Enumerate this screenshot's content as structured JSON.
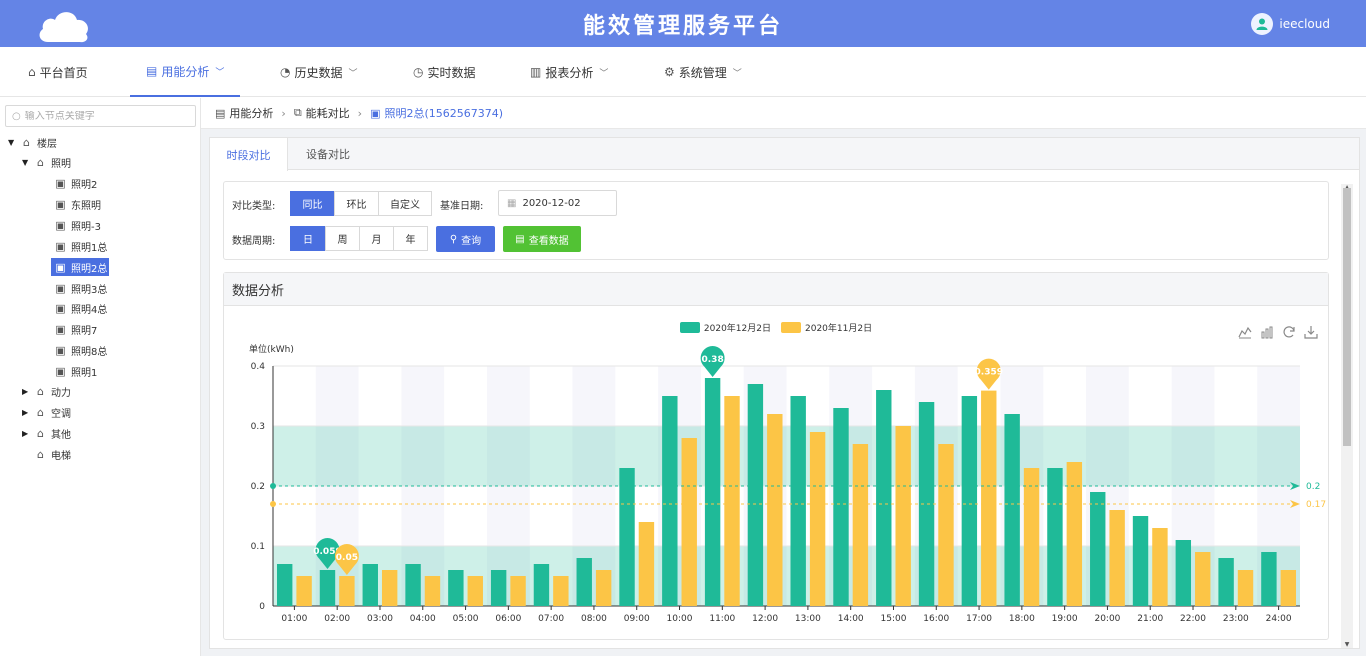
{
  "header": {
    "title": "能效管理服务平台",
    "username": "ieecloud",
    "logo_icon": "cloud-icon",
    "avatar_icon": "user-icon"
  },
  "nav": {
    "items": [
      {
        "label": "平台首页",
        "icon": "home-icon"
      },
      {
        "label": "用能分析",
        "icon": "document-icon",
        "dropdown": true,
        "active": true
      },
      {
        "label": "历史数据",
        "icon": "gauge-icon",
        "dropdown": true
      },
      {
        "label": "实时数据",
        "icon": "clock-icon"
      },
      {
        "label": "报表分析",
        "icon": "bar-chart-icon",
        "dropdown": true
      },
      {
        "label": "系统管理",
        "icon": "gear-icon",
        "dropdown": true
      }
    ]
  },
  "tree": {
    "search_placeholder": "输入节点关键字",
    "nodes": [
      {
        "label": "楼层",
        "expanded": true
      },
      {
        "label": "照明",
        "expanded": true
      },
      {
        "label": "照明2"
      },
      {
        "label": "东照明"
      },
      {
        "label": "照明-3"
      },
      {
        "label": "照明1总"
      },
      {
        "label": "照明2总",
        "selected": true
      },
      {
        "label": "照明3总"
      },
      {
        "label": "照明4总"
      },
      {
        "label": "照明7"
      },
      {
        "label": "照明8总"
      },
      {
        "label": "照明1"
      },
      {
        "label": "动力",
        "expanded": false
      },
      {
        "label": "空调",
        "expanded": false
      },
      {
        "label": "其他",
        "expanded": false
      },
      {
        "label": "电梯"
      }
    ]
  },
  "breadcrumb": [
    "用能分析",
    "能耗对比",
    "照明2总(1562567374)"
  ],
  "tabs": [
    {
      "label": "时段对比",
      "active": true
    },
    {
      "label": "设备对比"
    }
  ],
  "filter": {
    "compare_type_label": "对比类型:",
    "compare_types": [
      "同比",
      "环比",
      "自定义"
    ],
    "compare_type_selected": "同比",
    "base_date_label": "基准日期:",
    "base_date": "2020-12-02",
    "period_label": "数据周期:",
    "periods": [
      "日",
      "周",
      "月",
      "年"
    ],
    "period_selected": "日",
    "query_button": "查询",
    "view_data_button": "查看数据"
  },
  "chart_section_title": "数据分析",
  "colors": {
    "accent": "#4a6fe0",
    "header": "#6484e6",
    "series1": "#1fba98",
    "series2": "#fcc546",
    "green_button": "#52c234"
  },
  "chart_data": {
    "type": "bar",
    "ylabel": "单位(kWh)",
    "ylim": [
      0,
      0.4
    ],
    "yticks": [
      "0",
      "0.1",
      "0.2",
      "0.3",
      "0.4"
    ],
    "categories": [
      "01:00",
      "02:00",
      "03:00",
      "04:00",
      "05:00",
      "06:00",
      "07:00",
      "08:00",
      "09:00",
      "10:00",
      "11:00",
      "12:00",
      "13:00",
      "14:00",
      "15:00",
      "16:00",
      "17:00",
      "18:00",
      "19:00",
      "20:00",
      "21:00",
      "22:00",
      "23:00",
      "24:00"
    ],
    "series": [
      {
        "name": "2020年12月2日",
        "values": [
          0.07,
          0.06,
          0.07,
          0.07,
          0.06,
          0.06,
          0.07,
          0.08,
          0.23,
          0.35,
          0.38,
          0.37,
          0.35,
          0.33,
          0.36,
          0.34,
          0.35,
          0.32,
          0.23,
          0.19,
          0.15,
          0.11,
          0.08,
          0.09
        ],
        "average": 0.2,
        "average_label": "0.2"
      },
      {
        "name": "2020年11月2日",
        "values": [
          0.05,
          0.05,
          0.06,
          0.05,
          0.05,
          0.05,
          0.05,
          0.06,
          0.14,
          0.28,
          0.35,
          0.32,
          0.29,
          0.27,
          0.3,
          0.27,
          0.359,
          0.23,
          0.24,
          0.16,
          0.13,
          0.09,
          0.06,
          0.06
        ],
        "average": 0.17,
        "average_label": "0.17"
      }
    ],
    "mark_points": [
      {
        "series": 0,
        "index": 1,
        "label": "0.059"
      },
      {
        "series": 1,
        "index": 1,
        "label": "0.05"
      },
      {
        "series": 0,
        "index": 10,
        "label": "0.38"
      },
      {
        "series": 1,
        "index": 16,
        "label": "0.359"
      }
    ],
    "mark_areas": [
      {
        "from": 0,
        "to": 0.1
      },
      {
        "from": 0.2,
        "to": 0.3
      }
    ],
    "legend_position": "top-center",
    "toolbox": [
      "line-chart-icon",
      "bar-chart-icon",
      "refresh-icon",
      "download-icon"
    ]
  }
}
